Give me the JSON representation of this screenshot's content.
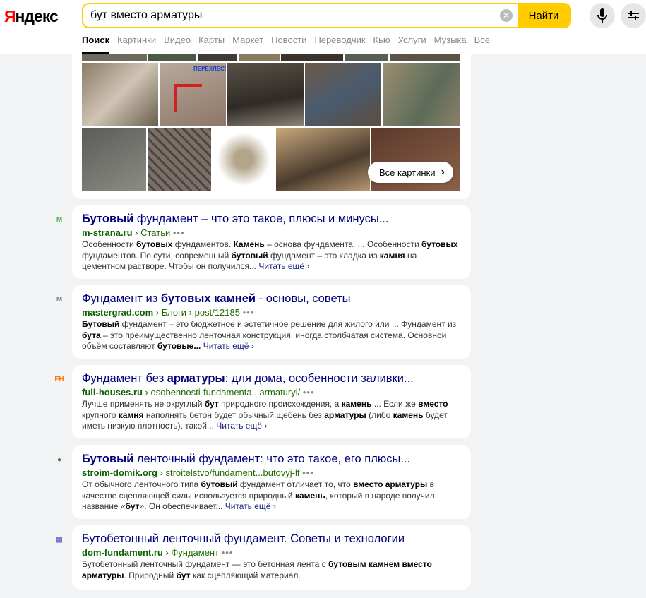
{
  "header": {
    "logo_prefix": "Я",
    "logo_rest": "ндекс",
    "query": "бут вместо арматуры",
    "find_label": "Найти",
    "clear_icon": "clear-icon",
    "mic_icon": "microphone-icon",
    "settings_icon": "filter-settings-icon"
  },
  "tabs": [
    "Поиск",
    "Картинки",
    "Видео",
    "Карты",
    "Маркет",
    "Новости",
    "Переводчик",
    "Кью",
    "Услуги",
    "Музыка",
    "Все"
  ],
  "gallery": {
    "all_label": "Все картинки",
    "overlay_text": "ПЕРЕХЛЕСТ"
  },
  "results": [
    {
      "favicon": "М",
      "favicon_color": "#4caf50",
      "title": [
        {
          "t": "Бутовый",
          "b": true
        },
        {
          "t": " фундамент – что это такое, плюсы и минусы..."
        }
      ],
      "domain": "m-strana.ru",
      "path": "Статьи",
      "snippet": [
        {
          "t": "Особенности "
        },
        {
          "t": "бутовых",
          "b": true
        },
        {
          "t": " фундаментов. "
        },
        {
          "t": "Камень",
          "b": true
        },
        {
          "t": " – основа фундамента. ... Особенности "
        },
        {
          "t": "бутовых",
          "b": true
        },
        {
          "t": " фундаментов. По сути, современный "
        },
        {
          "t": "бутовый",
          "b": true
        },
        {
          "t": " фундамент – это кладка из "
        },
        {
          "t": "камня",
          "b": true
        },
        {
          "t": " на цементном растворе. Чтобы он получился... "
        }
      ]
    },
    {
      "favicon": "M",
      "favicon_color": "#5f8f86",
      "title": [
        {
          "t": "Фундамент из "
        },
        {
          "t": "бутовых камней",
          "b": true
        },
        {
          "t": " - основы, советы"
        }
      ],
      "domain": "mastergrad.com",
      "path": "Блоги › post/12185",
      "snippet": [
        {
          "t": "Бутовый",
          "b": true
        },
        {
          "t": " фундамент – это бюджетное и эстетичное решение для жилого или ... Фундамент из "
        },
        {
          "t": "бута",
          "b": true
        },
        {
          "t": " – это преимущественно ленточная конструкция, иногда столбчатая система. Основной объём составляют "
        },
        {
          "t": "бутовые...",
          "b": true
        },
        {
          "t": " "
        }
      ]
    },
    {
      "favicon": "FH",
      "favicon_color": "#f57c00",
      "title": [
        {
          "t": "Фундамент без "
        },
        {
          "t": "арматуры",
          "b": true
        },
        {
          "t": ": для дома, особенности заливки..."
        }
      ],
      "domain": "full-houses.ru",
      "path": "osobennosti-fundamenta...armaturyi/",
      "snippet": [
        {
          "t": "Лучше применять не округлый "
        },
        {
          "t": "бут",
          "b": true
        },
        {
          "t": " природного происхождения, а "
        },
        {
          "t": "камень",
          "b": true
        },
        {
          "t": " ... Если же "
        },
        {
          "t": "вместо",
          "b": true
        },
        {
          "t": " крупного "
        },
        {
          "t": "камня",
          "b": true
        },
        {
          "t": " наполнять бетон будет обычный щебень без "
        },
        {
          "t": "арматуры",
          "b": true
        },
        {
          "t": " (либо "
        },
        {
          "t": "камень",
          "b": true
        },
        {
          "t": " будет иметь низкую плотность), такой... "
        }
      ]
    },
    {
      "favicon": "●",
      "favicon_color": "#3f6f4f",
      "title": [
        {
          "t": "Бутовый",
          "b": true
        },
        {
          "t": " ленточный фундамент: что это такое, его плюсы..."
        }
      ],
      "domain": "stroim-domik.org",
      "path": "stroitelstvo/fundament...butovyj-lf",
      "snippet": [
        {
          "t": "От обычного ленточного типа "
        },
        {
          "t": "бутовый",
          "b": true
        },
        {
          "t": " фундамент отличает то, что "
        },
        {
          "t": "вместо арматуры",
          "b": true
        },
        {
          "t": " в качестве сцепляющей силы используется природный "
        },
        {
          "t": "камень",
          "b": true
        },
        {
          "t": ", который в народе получил название «"
        },
        {
          "t": "бут",
          "b": true
        },
        {
          "t": "». Он обеспечивает... "
        }
      ]
    },
    {
      "favicon": "▦",
      "favicon_color": "#7b6fd0",
      "title": [
        {
          "t": "Бутобетонный ленточный фундамент. Советы и технологии"
        }
      ],
      "domain": "dom-fundament.ru",
      "path": "Фундамент",
      "snippet": [
        {
          "t": "Бутобетонный ленточный фундамент — это бетонная лента с "
        },
        {
          "t": "бутовым камнем вместо арматуры",
          "b": true
        },
        {
          "t": ". Природный "
        },
        {
          "t": "бут",
          "b": true
        },
        {
          "t": " как сцепляющий материал."
        }
      ],
      "no_readmore": true
    }
  ],
  "read_more": "Читать ещё"
}
